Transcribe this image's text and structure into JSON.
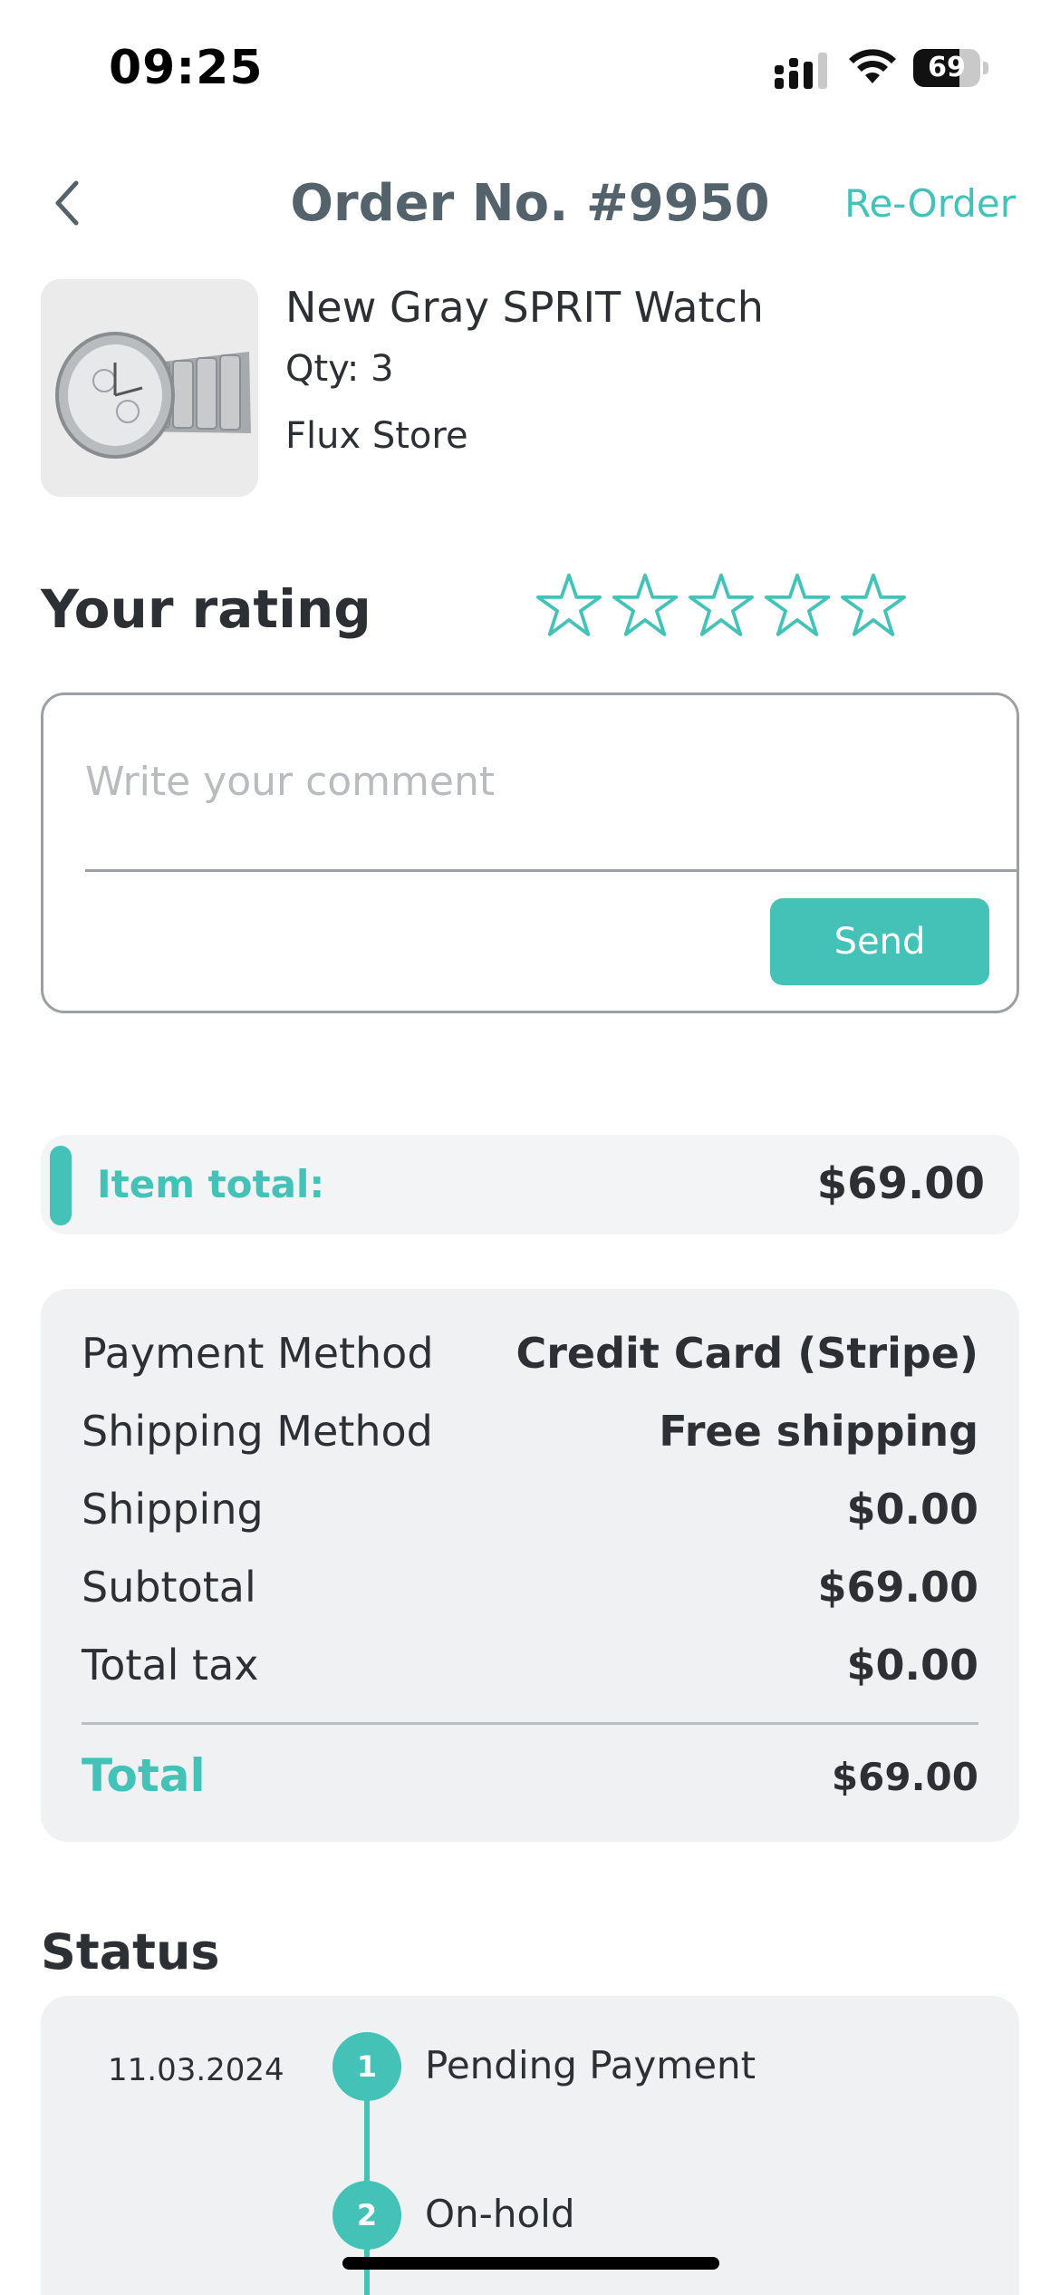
{
  "status_bar": {
    "time": "09:25",
    "battery_level": "69",
    "battery_fraction": 0.69,
    "icons": [
      "signal-icon",
      "wifi-icon",
      "battery-icon"
    ]
  },
  "header": {
    "title": "Order No. #9950",
    "back_icon": "chevron-left-icon",
    "reorder_label": "Re-Order"
  },
  "product": {
    "image": "watch-product-image",
    "name": "New Gray SPRIT Watch",
    "qty": "Qty: 3",
    "store": "Flux Store"
  },
  "rating": {
    "title": "Your rating",
    "stars_selected": 0,
    "stars_total": 5,
    "star_icon": "star-outline-icon"
  },
  "comment": {
    "placeholder": "Write your comment",
    "value": "",
    "send_label": "Send"
  },
  "item_total": {
    "label": "Item total:",
    "value": "$69.00"
  },
  "summary": {
    "rows": [
      {
        "label": "Payment Method",
        "value": "Credit Card (Stripe)"
      },
      {
        "label": "Shipping Method",
        "value": "Free shipping"
      },
      {
        "label": "Shipping",
        "value": "$0.00"
      },
      {
        "label": "Subtotal",
        "value": "$69.00"
      },
      {
        "label": "Total tax",
        "value": "$0.00"
      }
    ],
    "total_label": "Total",
    "total_value": "$69.00"
  },
  "status": {
    "title": "Status",
    "steps": [
      {
        "number": "1",
        "date": "11.03.2024",
        "label": "Pending Payment"
      },
      {
        "number": "2",
        "date": "",
        "label": "On-hold"
      }
    ]
  },
  "colors": {
    "accent": "#44c2b8",
    "title_gray": "#54626c",
    "card_bg": "#f0f1f2",
    "text": "#2c3035"
  }
}
